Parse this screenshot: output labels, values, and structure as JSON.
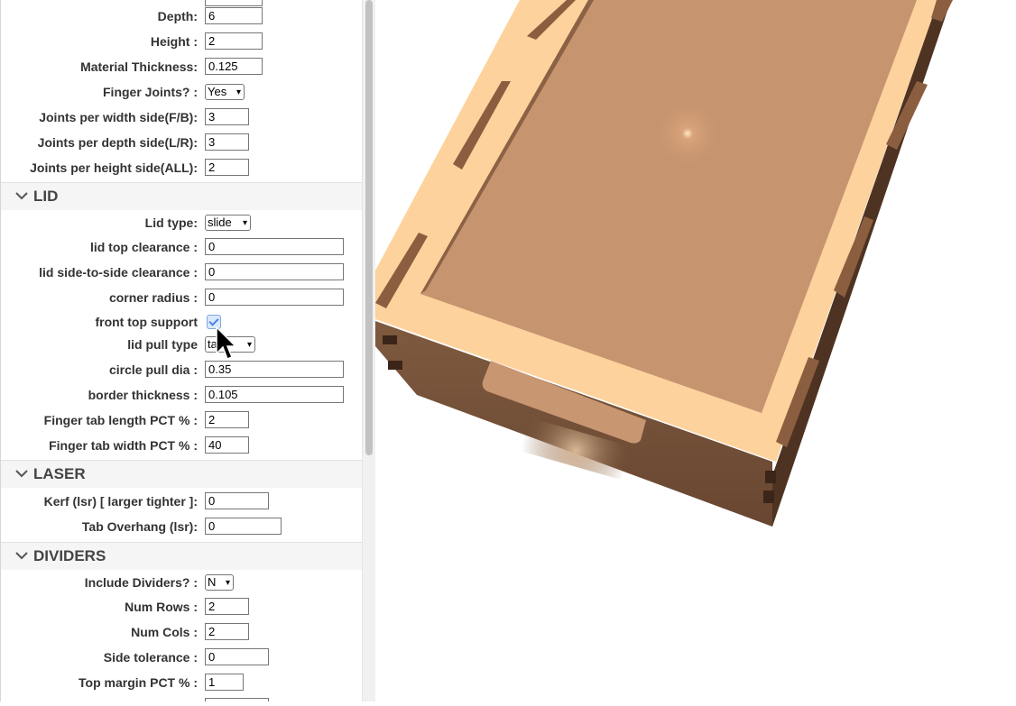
{
  "dimensions": {
    "depth": {
      "label": "Depth:",
      "value": "6"
    },
    "height": {
      "label": "Height :",
      "value": "2"
    },
    "material_thickness": {
      "label": "Material Thickness:",
      "value": "0.125"
    },
    "finger_joints": {
      "label": "Finger Joints? :",
      "value": "Yes"
    },
    "joints_width": {
      "label": "Joints per width side(F/B):",
      "value": "3"
    },
    "joints_depth": {
      "label": "Joints per depth side(L/R):",
      "value": "3"
    },
    "joints_height": {
      "label": "Joints per height side(ALL):",
      "value": "2"
    }
  },
  "lid": {
    "title": "LID",
    "lid_type": {
      "label": "Lid type:",
      "value": "slide"
    },
    "top_clearance": {
      "label": "lid top clearance :",
      "value": "0"
    },
    "side_clearance": {
      "label": "lid side-to-side clearance :",
      "value": "0"
    },
    "corner_radius": {
      "label": "corner radius :",
      "value": "0"
    },
    "front_top_support": {
      "label": "front top support",
      "checked": true
    },
    "pull_type": {
      "label": "lid pull type",
      "value": "ta"
    },
    "circle_pull_dia": {
      "label": "circle pull dia :",
      "value": "0.35"
    },
    "border_thickness": {
      "label": "border thickness :",
      "value": "0.105"
    },
    "tab_length": {
      "label": "Finger tab length PCT % :",
      "value": "2"
    },
    "tab_width": {
      "label": "Finger tab width PCT % :",
      "value": "40"
    }
  },
  "laser": {
    "title": "LASER",
    "kerf": {
      "label": "Kerf (lsr) [ larger tighter ]:",
      "value": "0"
    },
    "tab_overhang": {
      "label": "Tab Overhang (lsr):",
      "value": "0"
    }
  },
  "dividers": {
    "title": "DIVIDERS",
    "include": {
      "label": "Include Dividers? :",
      "value": "N"
    },
    "num_rows": {
      "label": "Num Rows :",
      "value": "2"
    },
    "num_cols": {
      "label": "Num Cols :",
      "value": "2"
    },
    "side_tolerance": {
      "label": "Side tolerance :",
      "value": "0"
    },
    "top_margin": {
      "label": "Top margin PCT % :",
      "value": "1"
    }
  },
  "colors": {
    "wood_light": "#fdd29c",
    "wood_mid": "#c6946f",
    "wood_dark": "#6d4a33"
  }
}
